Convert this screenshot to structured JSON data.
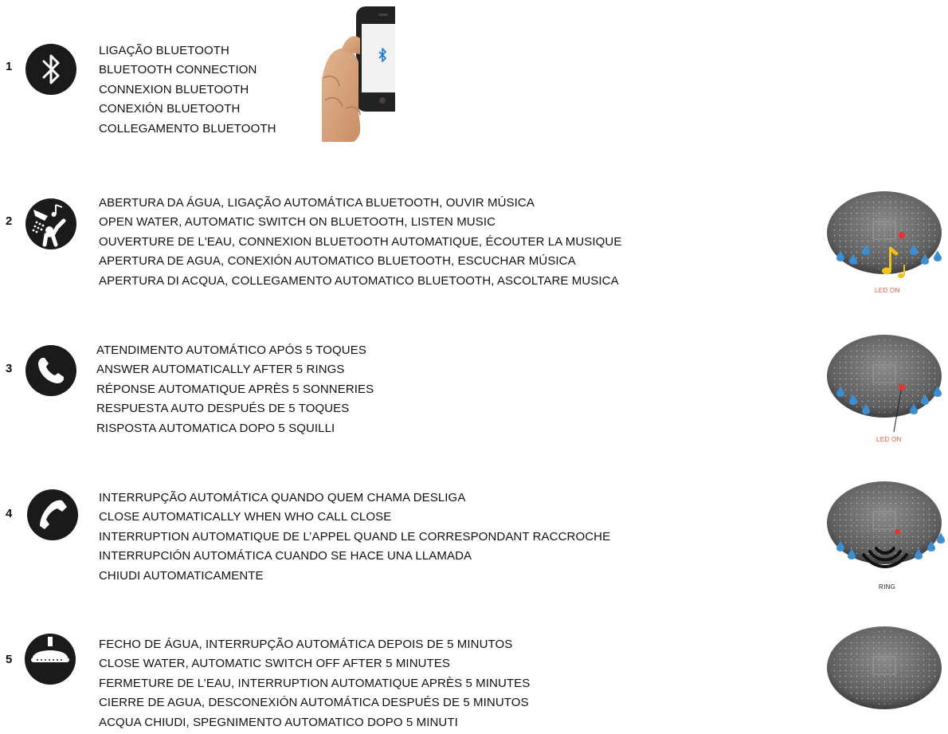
{
  "steps": [
    {
      "number": "1",
      "icon": "bluetooth-icon",
      "lines": [
        "LIGAÇÃO BLUETOOTH",
        "BLUETOOTH CONNECTION",
        "CONNEXION BLUETOOTH",
        "CONEXIÓN BLUETOOTH",
        "COLLEGAMENTO BLUETOOTH"
      ]
    },
    {
      "number": "2",
      "icon": "shower-music-icon",
      "lines": [
        "ABERTURA DA ÁGUA, LIGAÇÃO AUTOMÁTICA BLUETOOTH, OUVIR MÚSICA",
        "OPEN WATER, AUTOMATIC SWITCH ON BLUETOOTH, LISTEN MUSIC",
        "OUVERTURE DE L'EAU, CONNEXION BLUETOOTH AUTOMATIQUE, ÉCOUTER LA MUSIQUE",
        "APERTURA DE AGUA, CONEXIÓN AUTOMATICO BLUETOOTH, ESCUCHAR MÚSICA",
        "APERTURA DI ACQUA, COLLEGAMENTO AUTOMATICO BLUETOOTH, ASCOLTARE MUSICA"
      ]
    },
    {
      "number": "3",
      "icon": "phone-answer-icon",
      "lines": [
        "ATENDIMENTO AUTOMÁTICO APÓS 5 TOQUES",
        "ANSWER AUTOMATICALLY AFTER 5 RINGS",
        "RÉPONSE AUTOMATIQUE APRÈS 5 SONNERIES",
        "RESPUESTA AUTO DESPUÉS DE 5 TOQUES",
        "RISPOSTA AUTOMATICA DOPO 5 SQUILLI"
      ]
    },
    {
      "number": "4",
      "icon": "phone-hangup-icon",
      "lines": [
        "INTERRUPÇÃO AUTOMÁTICA QUANDO QUEM CHAMA DESLIGA",
        "CLOSE AUTOMATICALLY WHEN WHO CALL CLOSE",
        "INTERRUPTION AUTOMATIQUE DE L’APPEL QUAND LE CORRESPONDANT RACCROCHE",
        "INTERRUPCIÓN AUTOMÁTICA CUANDO SE HACE UNA LLAMADA",
        "CHIUDI AUTOMATICAMENTE"
      ]
    },
    {
      "number": "5",
      "icon": "shower-head-icon",
      "lines": [
        "FECHO DE ÁGUA, INTERRUPÇÃO AUTOMÁTICA DEPOIS DE 5 MINUTOS",
        "CLOSE WATER, AUTOMATIC SWITCH OFF AFTER 5 MINUTES",
        "FERMETURE DE L’EAU, INTERRUPTION AUTOMATIQUE APRÈS 5 MINUTES",
        "CIERRE DE AGUA, DESCONEXIÓN AUTOMÁTICA DESPUÉS DE 5 MINUTOS",
        "ACQUA CHIUDI, SPEGNIMENTO AUTOMATICO DOPO 5 MINUTI"
      ]
    }
  ],
  "illustrations": {
    "captions": [
      "LED ON",
      "LED ON",
      "RING"
    ]
  },
  "colors": {
    "text": "#111111",
    "icon_bg": "#1a1a1a",
    "led": "#e8322a",
    "caption": "#e05a3a",
    "water": "#3b8fd1",
    "music": "#f2c21a",
    "bluetooth_blue": "#1d73d6"
  }
}
